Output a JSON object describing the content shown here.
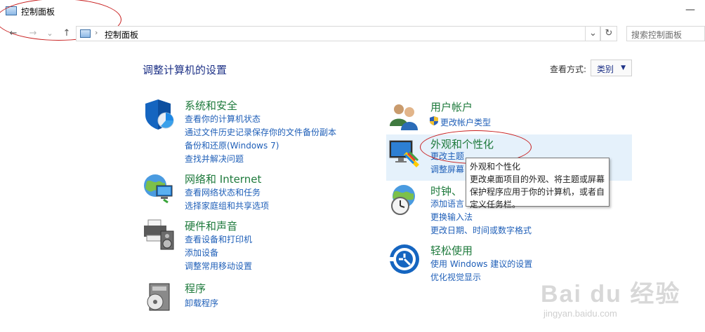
{
  "window": {
    "title": "控制面板",
    "minimize_glyph": "—"
  },
  "nav": {
    "back": "←",
    "forward": "→",
    "recent": "⌄",
    "up": "↑",
    "address_sep": "›",
    "address": "控制面板",
    "dropdown": "⌄",
    "refresh": "↻",
    "search_placeholder": "搜索控制面板"
  },
  "main": {
    "heading": "调整计算机的设置",
    "view_label": "查看方式:",
    "view_value": "类别",
    "view_arrow": "▼"
  },
  "categories_left": [
    {
      "title": "系统和安全",
      "icon": "shield-icon",
      "links": [
        "查看你的计算机状态",
        "通过文件历史记录保存你的文件备份副本",
        "备份和还原(Windows 7)",
        "查找并解决问题"
      ]
    },
    {
      "title": "网络和 Internet",
      "icon": "network-globe-icon",
      "links": [
        "查看网络状态和任务",
        "选择家庭组和共享选项"
      ]
    },
    {
      "title": "硬件和声音",
      "icon": "printer-speaker-icon",
      "links": [
        "查看设备和打印机",
        "添加设备",
        "调整常用移动设置"
      ]
    },
    {
      "title": "程序",
      "icon": "programs-disc-icon",
      "links": [
        "卸载程序"
      ]
    }
  ],
  "categories_right": [
    {
      "title": "用户帐户",
      "icon": "users-icon",
      "links": [
        "更改帐户类型"
      ]
    },
    {
      "title": "外观和个性化",
      "icon": "monitor-palette-icon",
      "links": [
        "更改主题",
        "调整屏幕"
      ]
    },
    {
      "title": "时钟、",
      "icon": "clock-globe-icon",
      "links": [
        "添加语言",
        "更换输入法",
        "更改日期、时间或数字格式"
      ]
    },
    {
      "title": "轻松使用",
      "icon": "ease-of-access-icon",
      "links": [
        "使用 Windows 建议的设置",
        "优化视觉显示"
      ]
    }
  ],
  "tooltip": {
    "title": "外观和个性化",
    "line1": "更改桌面项目的外观、将主题或屏幕",
    "line2": "保护程序应用于你的计算机，或者自",
    "line3": "定义任务栏。"
  },
  "watermark": {
    "main": "Bai du 经验",
    "sub": "jingyan.baidu.com"
  },
  "colors": {
    "category_title": "#1e7a3c",
    "link": "#1f5fb8",
    "heading": "#1e3287",
    "hover_highlight": "#e5f1fb",
    "annotation": "#c81e1e"
  }
}
